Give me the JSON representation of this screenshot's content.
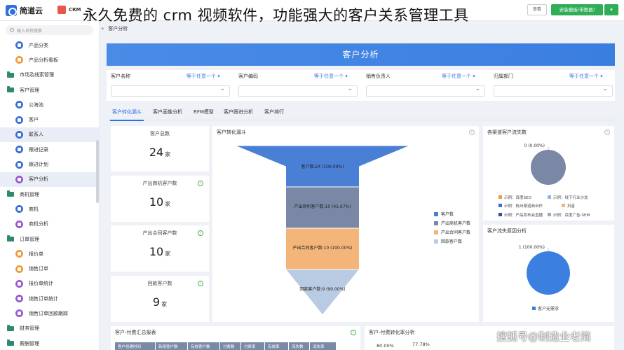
{
  "header": {
    "logo_text": "简道云",
    "crm_label": "CRM",
    "overlay_title": "永久免费的 crm 视频软件，功能强大的客户关系管理工具",
    "small_button": "查看",
    "install_button": "安装模板(带数据)",
    "extra_icon": "chevron-down-icon"
  },
  "sidebar": {
    "search_placeholder": "输入名称搜索",
    "items": [
      {
        "label": "产品分类",
        "level": "child",
        "icon": "blue"
      },
      {
        "label": "产品分析看板",
        "level": "child",
        "icon": "orange"
      },
      {
        "label": "市场及线索管理",
        "level": "group"
      },
      {
        "label": "客户管理",
        "level": "group"
      },
      {
        "label": "公海池",
        "level": "child",
        "icon": "blue"
      },
      {
        "label": "客户",
        "level": "child",
        "icon": "blue"
      },
      {
        "label": "联系人",
        "level": "child",
        "icon": "blue",
        "active": true
      },
      {
        "label": "跟进记录",
        "level": "child",
        "icon": "blue"
      },
      {
        "label": "跟进计划",
        "level": "child",
        "icon": "blue"
      },
      {
        "label": "客户分析",
        "level": "child",
        "icon": "purple",
        "active": true
      },
      {
        "label": "商机管理",
        "level": "group"
      },
      {
        "label": "商机",
        "level": "child",
        "icon": "blue"
      },
      {
        "label": "商机分析",
        "level": "child",
        "icon": "purple"
      },
      {
        "label": "订单管理",
        "level": "group"
      },
      {
        "label": "报价单",
        "level": "child",
        "icon": "orange"
      },
      {
        "label": "销售订单",
        "level": "child",
        "icon": "orange"
      },
      {
        "label": "报价单统计",
        "level": "child",
        "icon": "purple"
      },
      {
        "label": "销售订单统计",
        "level": "child",
        "icon": "purple"
      },
      {
        "label": "销售订单回款跟踪",
        "level": "child",
        "icon": "purple"
      },
      {
        "label": "财务管理",
        "level": "group"
      },
      {
        "label": "薪酬管理",
        "level": "group"
      }
    ]
  },
  "breadcrumb": {
    "chevron": "«",
    "label": "客户分析"
  },
  "banner": {
    "title": "客户分析"
  },
  "filters": [
    {
      "label": "客户名称",
      "any": "等于任意一个 ▾"
    },
    {
      "label": "客户编码",
      "any": "等于任意一个 ▾"
    },
    {
      "label": "销售负责人",
      "any": "等于任意一个 ▾"
    },
    {
      "label": "归属部门",
      "any": "等于任意一个 ▾"
    }
  ],
  "tabs": [
    "客户转化漏斗",
    "客户画像分析",
    "RFM模型",
    "客户跟进分析",
    "客户排行"
  ],
  "kpis": [
    {
      "label": "客户总数",
      "value": "24",
      "unit": "家"
    },
    {
      "label": "产出商机客户数",
      "value": "10",
      "unit": "家"
    },
    {
      "label": "产出合同客户数",
      "value": "10",
      "unit": "家"
    },
    {
      "label": "回款客户数",
      "value": "9",
      "unit": "家"
    }
  ],
  "panels": {
    "funnel_title": "客户转化漏斗",
    "churn_title": "各渠道客户流失数",
    "reason_title": "客户流失原因分析",
    "table_title": "客户-付费汇总报表",
    "rate_title": "客户-付费转化率分析"
  },
  "table_headers": [
    "客户创建时间",
    "新增客户数",
    "有效客户数",
    "付费数",
    "付费率",
    "有效率",
    "流失数",
    "流失率"
  ],
  "rate_values": {
    "left": "80.00%",
    "right": "77.78%"
  },
  "watermark": "搜狐号@制造业老简",
  "colors": {
    "accent": "#2f6fde",
    "install": "#2fae57",
    "funnel1": "#4a7fd6",
    "funnel2": "#7a88a6",
    "funnel3": "#f4b57a",
    "funnel4": "#b9cbe3"
  },
  "chart_data": [
    {
      "type": "funnel",
      "title": "客户转化漏斗",
      "categories": [
        "客户数",
        "产出商机客户数",
        "产出合同客户数",
        "回款客户数"
      ],
      "values": [
        24,
        10,
        10,
        9
      ],
      "labels": [
        "客户数:24 (100.00%)",
        "产出商机客户数:10 (41.67%)",
        "产出合同客户数:10 (100.00%)",
        "回款客户数:9 (90.00%)"
      ],
      "legend_position": "right"
    },
    {
      "type": "pie",
      "title": "各渠道客户流失数",
      "values": [
        0
      ],
      "data_label": "0 (0.00%)",
      "legend": [
        "示例：百度SEO",
        "示例：线下行业沙龙",
        "示例：杭州渠道商合作",
        "抖音",
        "示例：产品发布会直播",
        "示例：百度广告-SEM"
      ],
      "legend_colors": [
        "#f19a38",
        "#8fb2e8",
        "#3b6fd6",
        "#f4b57a",
        "#2f4f8f",
        "#9aa8c0"
      ],
      "legend_position": "bottom"
    },
    {
      "type": "pie",
      "title": "客户流失原因分析",
      "values": [
        1
      ],
      "data_label": "1 (100.00%)",
      "legend": [
        "客户无需求"
      ],
      "legend_position": "bottom"
    }
  ]
}
